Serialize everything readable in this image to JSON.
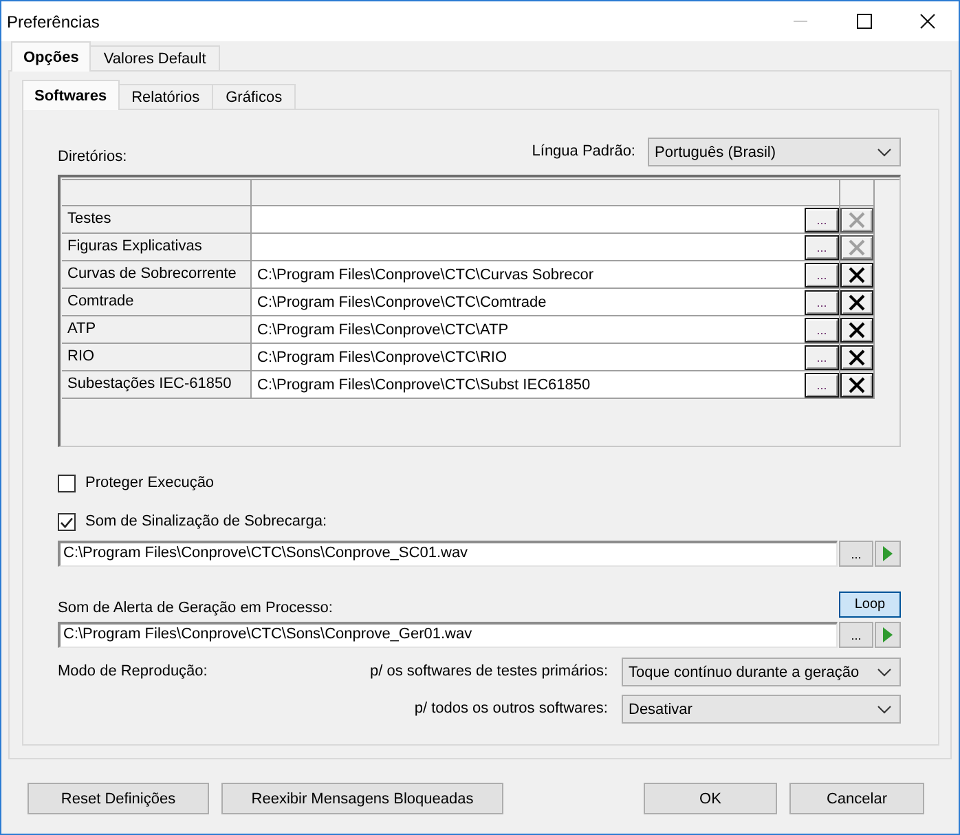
{
  "window": {
    "title": "Preferências",
    "minimize_disabled": true
  },
  "tabs": [
    {
      "label": "Opções",
      "selected": true
    },
    {
      "label": "Valores Default",
      "selected": false
    }
  ],
  "subtabs": [
    {
      "label": "Softwares",
      "selected": true
    },
    {
      "label": "Relatórios",
      "selected": false
    },
    {
      "label": "Gráficos",
      "selected": false
    }
  ],
  "directories": {
    "label": "Diretórios:",
    "rows": [
      {
        "name": "Testes",
        "browse": "...",
        "delete_disabled": true
      },
      {
        "name": "Figuras Explicativas",
        "browse": "...",
        "delete_disabled": true
      },
      {
        "name": "Curvas de Sobrecorrente",
        "path": "C:\\Program Files\\Conprove\\CTC\\Curvas Sobrecor",
        "browse": "...",
        "delete_disabled": false
      },
      {
        "name": "Comtrade",
        "path": "C:\\Program Files\\Conprove\\CTC\\Comtrade",
        "browse": "...",
        "delete_disabled": false
      },
      {
        "name": "ATP",
        "path": "C:\\Program Files\\Conprove\\CTC\\ATP",
        "browse": "...",
        "delete_disabled": false
      },
      {
        "name": "RIO",
        "path": "C:\\Program Files\\Conprove\\CTC\\RIO",
        "browse": "...",
        "delete_disabled": false
      },
      {
        "name": "Subestações IEC-61850",
        "path": "C:\\Program Files\\Conprove\\CTC\\Subst IEC61850",
        "browse": "...",
        "delete_disabled": false
      }
    ]
  },
  "language": {
    "label": "Língua Padrão:",
    "value": "Português (Brasil)"
  },
  "protect": {
    "label": "Proteger Execução",
    "checked": false
  },
  "overload_sound": {
    "label": "Som de Sinalização de Sobrecarga:",
    "checked": true,
    "file": "C:\\Program Files\\Conprove\\CTC\\Sons\\Conprove_SC01.wav",
    "browse": "..."
  },
  "alert_sound": {
    "label": "Som de Alerta de Geração em Processo:",
    "loop": {
      "label": "Loop",
      "on": true
    },
    "file": "C:\\Program Files\\Conprove\\CTC\\Sons\\Conprove_Ger01.wav",
    "browse": "..."
  },
  "playback_mode": {
    "label": "Modo de Reprodução:",
    "rows": [
      {
        "label": "p/ os softwares de testes primários:",
        "value": "Toque contínuo durante a geração"
      },
      {
        "label": "p/ todos os outros softwares:",
        "value": "Desativar"
      }
    ]
  },
  "footer": {
    "left": [
      {
        "label": "Reset Definições"
      },
      {
        "label": "Reexibir Mensagens Bloqueadas"
      }
    ],
    "right": [
      {
        "label": "OK"
      },
      {
        "label": "Cancelar"
      }
    ]
  }
}
